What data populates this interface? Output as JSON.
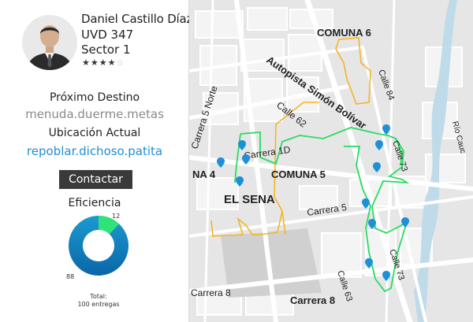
{
  "driver": {
    "name": "Daniel Castillo Díaz",
    "unit": "UVD 347",
    "sector": "Sector 1",
    "rating": {
      "filled": "★★★★",
      "empty": "☆"
    }
  },
  "next_destination": {
    "label": "Próximo Destino",
    "value": "menuda.duerme.metas"
  },
  "current_location": {
    "label": "Ubicación Actual",
    "value": "repoblar.dichoso.patita"
  },
  "contact_button": "Contactar",
  "efficiency": {
    "title": "Eficiencia",
    "chart_data": {
      "type": "pie",
      "categories": [
        "12",
        "88"
      ],
      "values": [
        12,
        88
      ],
      "colors": [
        "#2fe37a",
        "#1a8fc4"
      ]
    },
    "label_small": "12",
    "label_large": "88",
    "total_label": "Total:",
    "total_value": "100 entregas"
  },
  "map": {
    "labels": {
      "comuna6": "COMUNA 6",
      "autopista": "Autopista Simón Bolívar",
      "carrera5norte": "Carrera 5 Norte",
      "calle84": "Calle 84",
      "calle62": "Calle 62",
      "carrera1d": "Carrera 1D",
      "comuna4": "NA 4",
      "comuna5": "COMUNA 5",
      "calle73a": "Calle 73",
      "elsena": "EL SENA",
      "carrera5": "Carrera 5",
      "rio": "Río Cauc",
      "calle63": "Calle 63",
      "calle73b": "Calle 73",
      "carrera8a": "Carrera 8",
      "carrera8b": "Carrera 8"
    },
    "colors": {
      "route_green": "#28dc62",
      "route_orange": "#f5b428",
      "marker": "#1e90d8"
    }
  }
}
